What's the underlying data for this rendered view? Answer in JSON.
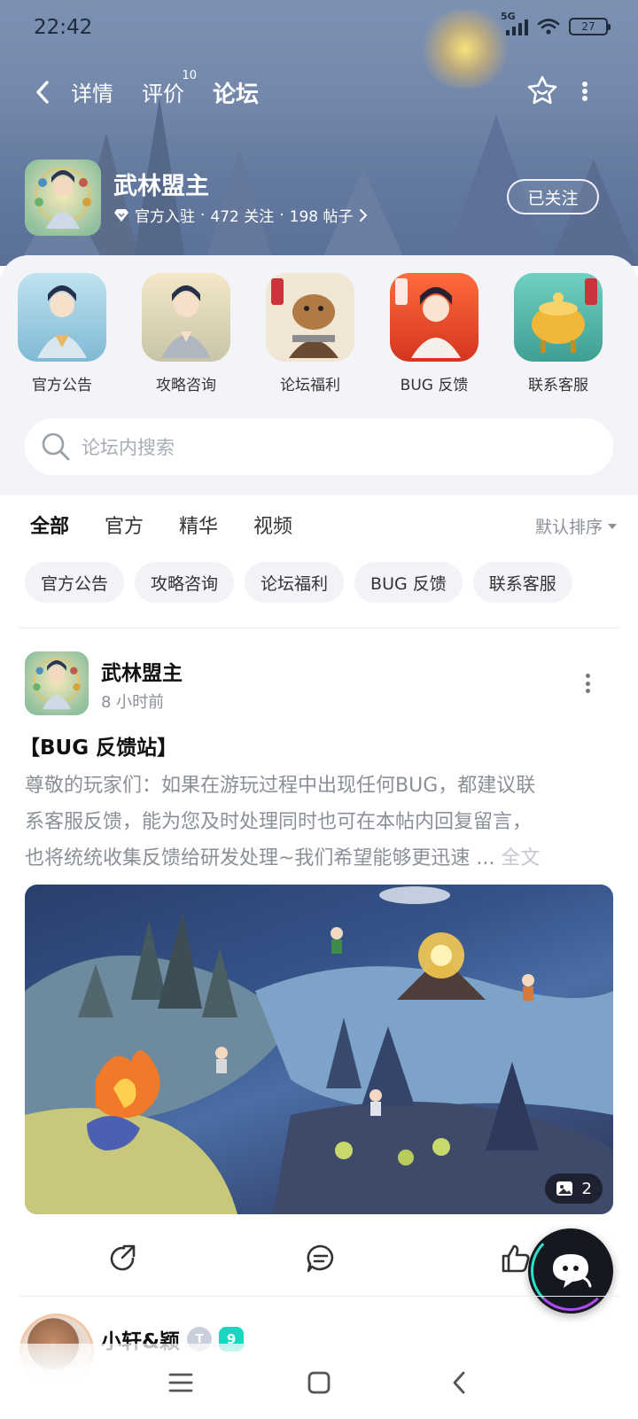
{
  "status": {
    "time": "22:42",
    "network": "5G",
    "battery": "27"
  },
  "nav": {
    "tabs": [
      {
        "label": "详情"
      },
      {
        "label": "评价",
        "badge": "10"
      },
      {
        "label": "论坛"
      }
    ]
  },
  "game": {
    "name": "武林盟主",
    "official_label": "官方入驻",
    "followers": "472 关注",
    "posts": "198 帖子",
    "follow_label": "已关注"
  },
  "categories": [
    {
      "label": "官方公告"
    },
    {
      "label": "攻略咨询"
    },
    {
      "label": "论坛福利"
    },
    {
      "label": "BUG 反馈"
    },
    {
      "label": "联系客服"
    }
  ],
  "search": {
    "placeholder": "论坛内搜索"
  },
  "filter_tabs": [
    {
      "label": "全部"
    },
    {
      "label": "官方"
    },
    {
      "label": "精华"
    },
    {
      "label": "视频"
    }
  ],
  "sort_label": "默认排序",
  "chips": [
    {
      "label": "官方公告"
    },
    {
      "label": "攻略咨询"
    },
    {
      "label": "论坛福利"
    },
    {
      "label": "BUG 反馈"
    },
    {
      "label": "联系客服"
    }
  ],
  "post": {
    "author": "武林盟主",
    "time": "8 小时前",
    "title": "【BUG 反馈站】",
    "body_lines": [
      "尊敬的玩家们：如果在游玩过程中出现任何BUG，都建议联",
      "系客服反馈，能为您及时处理同时也可在本帖内回复留言，",
      "也将统统收集反馈给研发处理~我们希望能够更迅速 ..."
    ],
    "more_label": "全文",
    "image_count": "2"
  },
  "next_post": {
    "author": "小轩&颖",
    "level_badge": "T",
    "vip_badge": "9"
  },
  "colors": {
    "accent": "#1ad5c0",
    "text_secondary": "#8a8f98",
    "panel_bg": "#f2f4f7"
  }
}
